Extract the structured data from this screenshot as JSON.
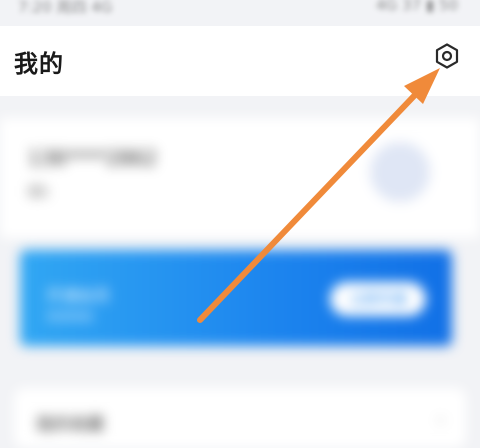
{
  "status_bar": {
    "time": "7:20 周四 4G",
    "right": "4G 37 ▮ 50"
  },
  "header": {
    "title": "我的",
    "settings_icon": "gear-icon"
  },
  "profile": {
    "phone": "136****2862",
    "subline": "ID:"
  },
  "vip_banner": {
    "title": "开通会员",
    "subtitle": "享受特权",
    "button_label": "立即开通"
  },
  "list": {
    "first_item": "我的收藏",
    "chevron": "›"
  },
  "colors": {
    "annotation_arrow": "#f08a3a",
    "banner_blue": "#1c84ee",
    "header_bg": "#ffffff"
  }
}
